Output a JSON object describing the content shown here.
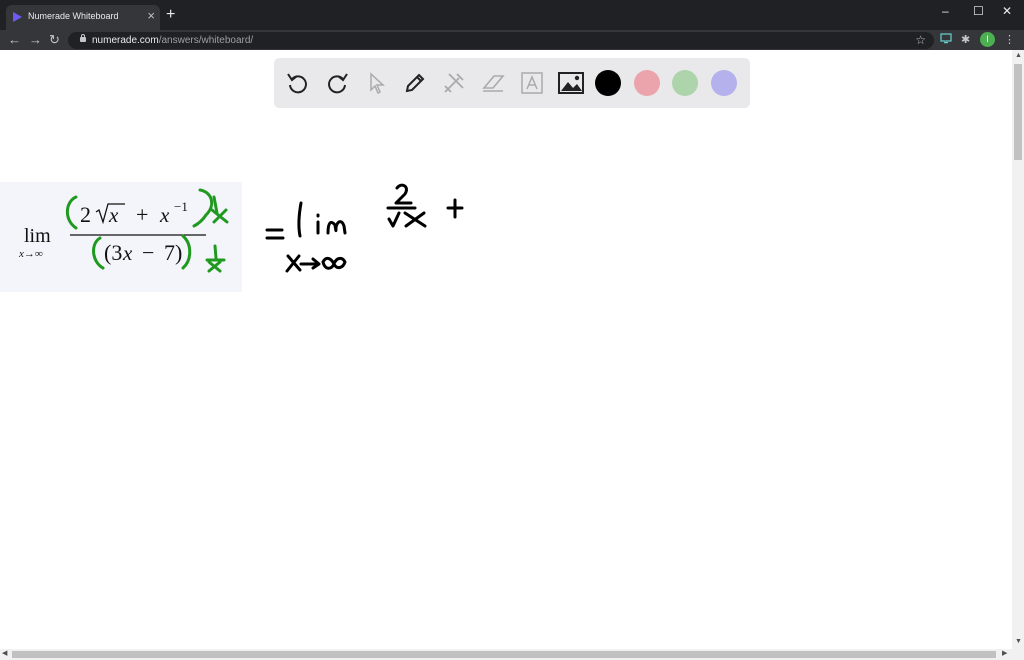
{
  "browser": {
    "tab_title": "Numerade Whiteboard",
    "url_host": "numerade.com",
    "url_path": "/answers/whiteboard/",
    "profile_initial": "I",
    "icons": {
      "close": "×",
      "new_tab": "+",
      "minimize": "–",
      "maximize": "☐",
      "window_close": "✕",
      "back": "←",
      "forward": "→",
      "reload": "↻",
      "star": "☆",
      "extensions": "✱",
      "menu": "⋮"
    }
  },
  "whiteboard": {
    "tools": [
      "undo-icon",
      "redo-icon",
      "pointer-icon",
      "pen-icon",
      "tools-icon",
      "eraser-icon",
      "text-icon",
      "image-icon"
    ],
    "colors": {
      "black": "#000000",
      "pink": "#eba4ab",
      "green": "#add4ab",
      "purple": "#b4b1ec"
    },
    "ink_colors": {
      "green": "#1f9a1f",
      "black": "#000000"
    }
  }
}
